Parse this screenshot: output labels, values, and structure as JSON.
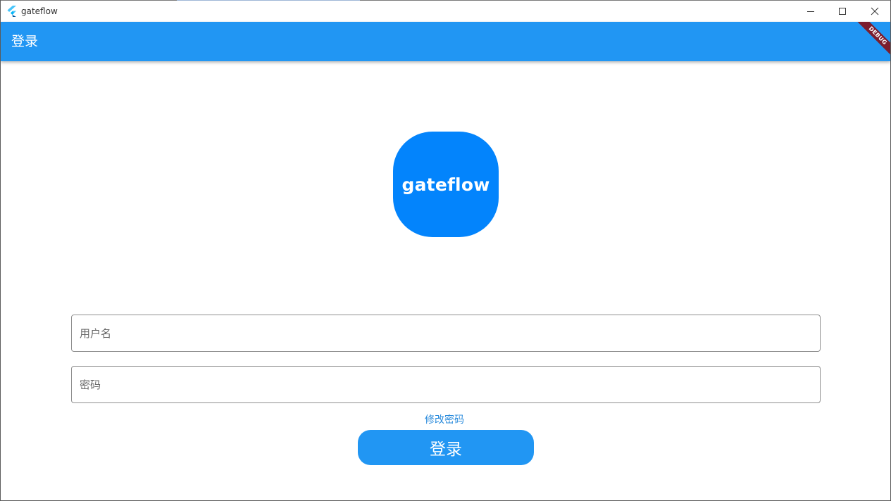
{
  "window": {
    "title": "gateflow",
    "app_icon": "flutter-icon",
    "controls": {
      "minimize_icon": "minimize-icon",
      "maximize_icon": "maximize-icon",
      "close_icon": "close-icon"
    }
  },
  "appbar": {
    "title": "登录",
    "debug_banner": "DEBUG",
    "background_color": "#2196f3"
  },
  "logo": {
    "text": "gateflow",
    "background_color": "#0384fc"
  },
  "form": {
    "username_placeholder": "用户名",
    "username_value": "",
    "password_placeholder": "密码",
    "password_value": "",
    "change_password_link": "修改密码",
    "login_button": "登录"
  }
}
